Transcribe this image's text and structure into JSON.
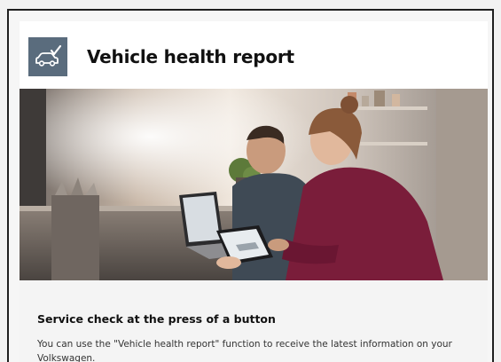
{
  "header": {
    "title": "Vehicle health report",
    "icon": "car-check-icon",
    "icon_bg": "#5a6c7d"
  },
  "hero": {
    "image": "kitchen-couple-laptop-tablet-photo"
  },
  "content": {
    "subtitle": "Service check at the press of a button",
    "description": "You can use the \"Vehicle health report\" function to receive the latest information on your Volkswagen."
  }
}
